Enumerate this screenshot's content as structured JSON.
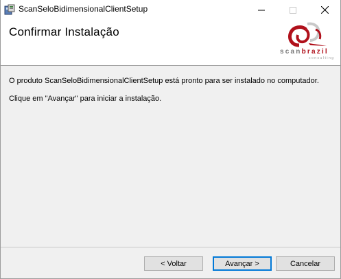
{
  "window": {
    "title": "ScanSeloBidimensionalClientSetup",
    "controls": {
      "minimize_icon": "minimize-icon",
      "maximize_icon": "maximize-icon",
      "close_icon": "close-icon"
    }
  },
  "header": {
    "title": "Confirmar Instalação",
    "logo": {
      "brand_scan": "scan",
      "brand_brazil": "brazil",
      "subtitle": "consulting",
      "colors": {
        "red": "#b0101b",
        "gray": "#7a7a7a"
      }
    }
  },
  "content": {
    "line1": "O produto ScanSeloBidimensionalClientSetup está pronto para ser instalado no computador.",
    "line2": "Clique em \"Avançar\" para iniciar a instalação."
  },
  "buttons": {
    "back": "< Voltar",
    "next": "Avançar >",
    "cancel": "Cancelar"
  },
  "colors": {
    "background": "#f0f0f0",
    "header_bg": "#ffffff",
    "focus_border": "#0078d7"
  }
}
